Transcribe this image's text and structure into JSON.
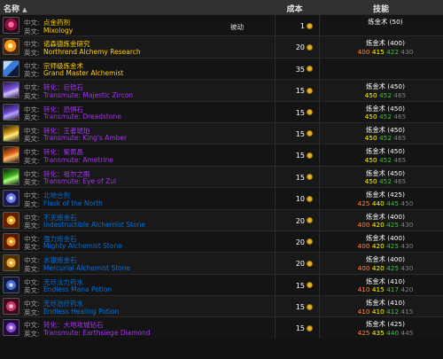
{
  "header": {
    "name": "名称",
    "cost": "成本",
    "skill": "技能"
  },
  "rows": [
    {
      "icon": "mixology-icon",
      "lbl_zh": "中文:",
      "lbl_en": "英文:",
      "zh": "点金药剂",
      "en": "Mixology",
      "quality": "gold",
      "note": "被动",
      "cost": "1",
      "skill_name": "炼金术",
      "skill_req": "(50)",
      "levels": []
    },
    {
      "icon": "northrend-research-icon",
      "lbl_zh": "中文:",
      "lbl_en": "英文:",
      "zh": "诺森德炼金研究",
      "en": "Northrend Alchemy Research",
      "quality": "gold",
      "note": "",
      "cost": "20",
      "skill_name": "炼金术",
      "skill_req": "(400)",
      "levels": [
        "400",
        "415",
        "422",
        "430"
      ]
    },
    {
      "icon": "grand-master-icon",
      "lbl_zh": "中文:",
      "lbl_en": "英文:",
      "zh": "宗师级炼金术",
      "en": "Grand Master Alchemist",
      "quality": "gold",
      "note": "",
      "cost": "35",
      "skill_name": "",
      "skill_req": "",
      "levels": []
    },
    {
      "icon": "majestic-zircon-icon",
      "lbl_zh": "中文:",
      "lbl_en": "英文:",
      "zh": "转化：巨锆石",
      "en": "Transmute: Majestic Zircon",
      "quality": "purple",
      "note": "",
      "cost": "15",
      "skill_name": "炼金术",
      "skill_req": "(450)",
      "levels": [
        "450",
        "452",
        "465"
      ]
    },
    {
      "icon": "dreadstone-icon",
      "lbl_zh": "中文:",
      "lbl_en": "英文:",
      "zh": "转化：恐惧石",
      "en": "Transmute: Dreadstone",
      "quality": "purple",
      "note": "",
      "cost": "15",
      "skill_name": "炼金术",
      "skill_req": "(450)",
      "levels": [
        "450",
        "452",
        "465"
      ]
    },
    {
      "icon": "kings-amber-icon",
      "lbl_zh": "中文:",
      "lbl_en": "英文:",
      "zh": "转化：王者琥珀",
      "en": "Transmute: King's Amber",
      "quality": "purple",
      "note": "",
      "cost": "15",
      "skill_name": "炼金术",
      "skill_req": "(450)",
      "levels": [
        "450",
        "452",
        "465"
      ]
    },
    {
      "icon": "ametrine-icon",
      "lbl_zh": "中文:",
      "lbl_en": "英文:",
      "zh": "转化：紫黄晶",
      "en": "Transmute: Ametrine",
      "quality": "purple",
      "note": "",
      "cost": "15",
      "skill_name": "炼金术",
      "skill_req": "(450)",
      "levels": [
        "450",
        "452",
        "465"
      ]
    },
    {
      "icon": "eye-of-zul-icon",
      "lbl_zh": "中文:",
      "lbl_en": "英文:",
      "zh": "转化：祖尔之眼",
      "en": "Transmute: Eye of Zul",
      "quality": "purple",
      "note": "",
      "cost": "15",
      "skill_name": "炼金术",
      "skill_req": "(450)",
      "levels": [
        "450",
        "452",
        "465"
      ]
    },
    {
      "icon": "flask-of-the-north-icon",
      "lbl_zh": "中文:",
      "lbl_en": "英文:",
      "zh": "北地合剂",
      "en": "Flask of the North",
      "quality": "blue",
      "note": "",
      "cost": "10",
      "skill_name": "炼金术",
      "skill_req": "(425)",
      "levels": [
        "425",
        "440",
        "445",
        "450"
      ]
    },
    {
      "icon": "indestructible-stone-icon",
      "lbl_zh": "中文:",
      "lbl_en": "英文:",
      "zh": "不灭炼金石",
      "en": "Indestructible Alchemist Stone",
      "quality": "blue",
      "note": "",
      "cost": "20",
      "skill_name": "炼金术",
      "skill_req": "(400)",
      "levels": [
        "400",
        "420",
        "425",
        "430"
      ]
    },
    {
      "icon": "mighty-stone-icon",
      "lbl_zh": "中文:",
      "lbl_en": "英文:",
      "zh": "强力炼金石",
      "en": "Mighty Alchemist Stone",
      "quality": "blue",
      "note": "",
      "cost": "20",
      "skill_name": "炼金术",
      "skill_req": "(400)",
      "levels": [
        "400",
        "420",
        "425",
        "430"
      ]
    },
    {
      "icon": "mercurial-stone-icon",
      "lbl_zh": "中文:",
      "lbl_en": "英文:",
      "zh": "水银炼金石",
      "en": "Mercurial Alchemist Stone",
      "quality": "blue",
      "note": "",
      "cost": "20",
      "skill_name": "炼金术",
      "skill_req": "(400)",
      "levels": [
        "400",
        "420",
        "425",
        "430"
      ]
    },
    {
      "icon": "endless-mana-icon",
      "lbl_zh": "中文:",
      "lbl_en": "英文:",
      "zh": "无尽法力药水",
      "en": "Endless Mana Potion",
      "quality": "blue",
      "note": "",
      "cost": "15",
      "skill_name": "炼金术",
      "skill_req": "(410)",
      "levels": [
        "410",
        "415",
        "417",
        "420"
      ]
    },
    {
      "icon": "endless-healing-icon",
      "lbl_zh": "中文:",
      "lbl_en": "英文:",
      "zh": "无尽治疗药水",
      "en": "Endless Healing Potion",
      "quality": "blue",
      "note": "",
      "cost": "15",
      "skill_name": "炼金术",
      "skill_req": "(410)",
      "levels": [
        "410",
        "410",
        "412",
        "415"
      ]
    },
    {
      "icon": "earthsiege-diamond-icon",
      "lbl_zh": "中文:",
      "lbl_en": "英文:",
      "zh": "转化：大地攻城钻石",
      "en": "Transmute: Earthsiege Diamond",
      "quality": "purple",
      "note": "",
      "cost": "15",
      "skill_name": "炼金术",
      "skill_req": "(425)",
      "levels": [
        "425",
        "435",
        "440",
        "445"
      ]
    }
  ],
  "colors": {
    "header_bg": "#313131",
    "row_bg": "#191919",
    "gold": "#ffd100",
    "purple": "#a335ee",
    "blue": "#0070dd",
    "coin": "#e2b42a"
  }
}
